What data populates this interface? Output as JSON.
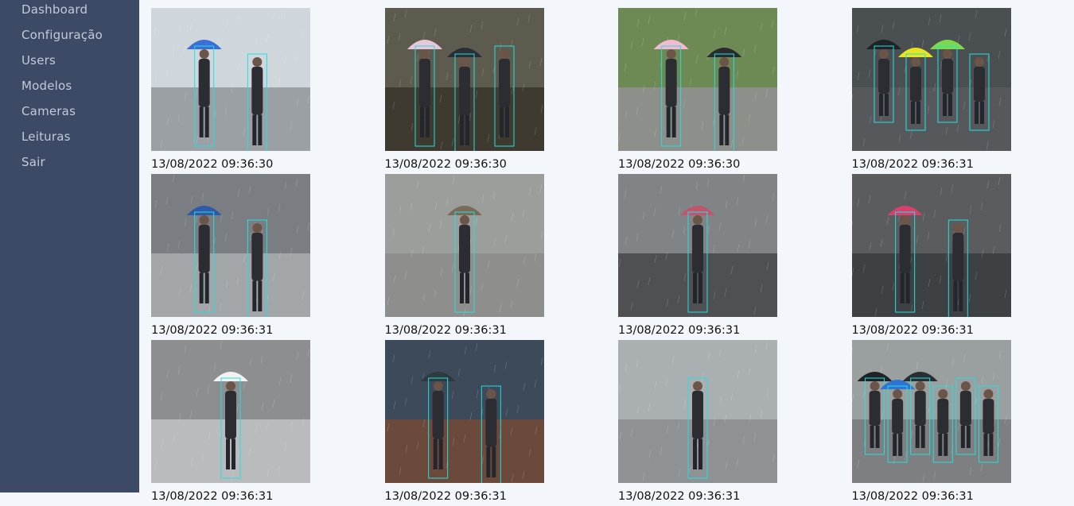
{
  "sidebar": {
    "items": [
      {
        "label": "Dashboard"
      },
      {
        "label": "Configuração"
      },
      {
        "label": "Users"
      },
      {
        "label": "Modelos"
      },
      {
        "label": "Cameras"
      },
      {
        "label": "Leituras"
      },
      {
        "label": "Sair"
      }
    ]
  },
  "gallery": {
    "items": [
      {
        "timestamp": "13/08/2022 09:36:30",
        "sky": "#cfd6dc",
        "ground": "#9aa0a4",
        "umbrellas": [
          "#3b6fd6"
        ],
        "people": 2
      },
      {
        "timestamp": "13/08/2022 09:36:30",
        "sky": "#5d5a4e",
        "ground": "#3f3a30",
        "umbrellas": [
          "#e8c8d8",
          "#2a2e36"
        ],
        "people": 3
      },
      {
        "timestamp": "13/08/2022 09:36:30",
        "sky": "#6d8a55",
        "ground": "#8c8f8a",
        "umbrellas": [
          "#f2b9cf",
          "#2a2b2e"
        ],
        "people": 2
      },
      {
        "timestamp": "13/08/2022 09:36:31",
        "sky": "#4a4f52",
        "ground": "#55595c",
        "umbrellas": [
          "#1f2326",
          "#e8e420",
          "#7ed94a"
        ],
        "people": 4
      },
      {
        "timestamp": "13/08/2022 09:36:31",
        "sky": "#7a7e82",
        "ground": "#a3a6a8",
        "umbrellas": [
          "#2e5aa8"
        ],
        "people": 2
      },
      {
        "timestamp": "13/08/2022 09:36:31",
        "sky": "#9c9e9c",
        "ground": "#8e8f8c",
        "umbrellas": [
          "#7a6a58"
        ],
        "people": 1
      },
      {
        "timestamp": "13/08/2022 09:36:31",
        "sky": "#808486",
        "ground": "#4e5052",
        "umbrellas": [
          "#c0566e"
        ],
        "people": 1
      },
      {
        "timestamp": "13/08/2022 09:36:31",
        "sky": "#5a5c5e",
        "ground": "#3e4144",
        "umbrellas": [
          "#d6406e"
        ],
        "people": 2
      },
      {
        "timestamp": "13/08/2022 09:36:31",
        "sky": "#8c8e90",
        "ground": "#b9bbbc",
        "umbrellas": [
          "#f2f2f2"
        ],
        "people": 1
      },
      {
        "timestamp": "13/08/2022 09:36:31",
        "sky": "#3c4a5a",
        "ground": "#6b4a3c",
        "umbrellas": [
          "#2e3a3e"
        ],
        "people": 2
      },
      {
        "timestamp": "13/08/2022 09:36:31",
        "sky": "#aab0b2",
        "ground": "#8f9294",
        "umbrellas": [],
        "people": 1
      },
      {
        "timestamp": "13/08/2022 09:36:31",
        "sky": "#9aa0a0",
        "ground": "#7d7f80",
        "umbrellas": [
          "#1f2326",
          "#2e74d2",
          "#2a2e32"
        ],
        "people": 6
      }
    ]
  },
  "colors": {
    "sidebar_bg": "#3c4a66",
    "sidebar_text": "#c3cad8",
    "page_bg": "#f3f6fa",
    "detection_box": "#22e0e0"
  }
}
